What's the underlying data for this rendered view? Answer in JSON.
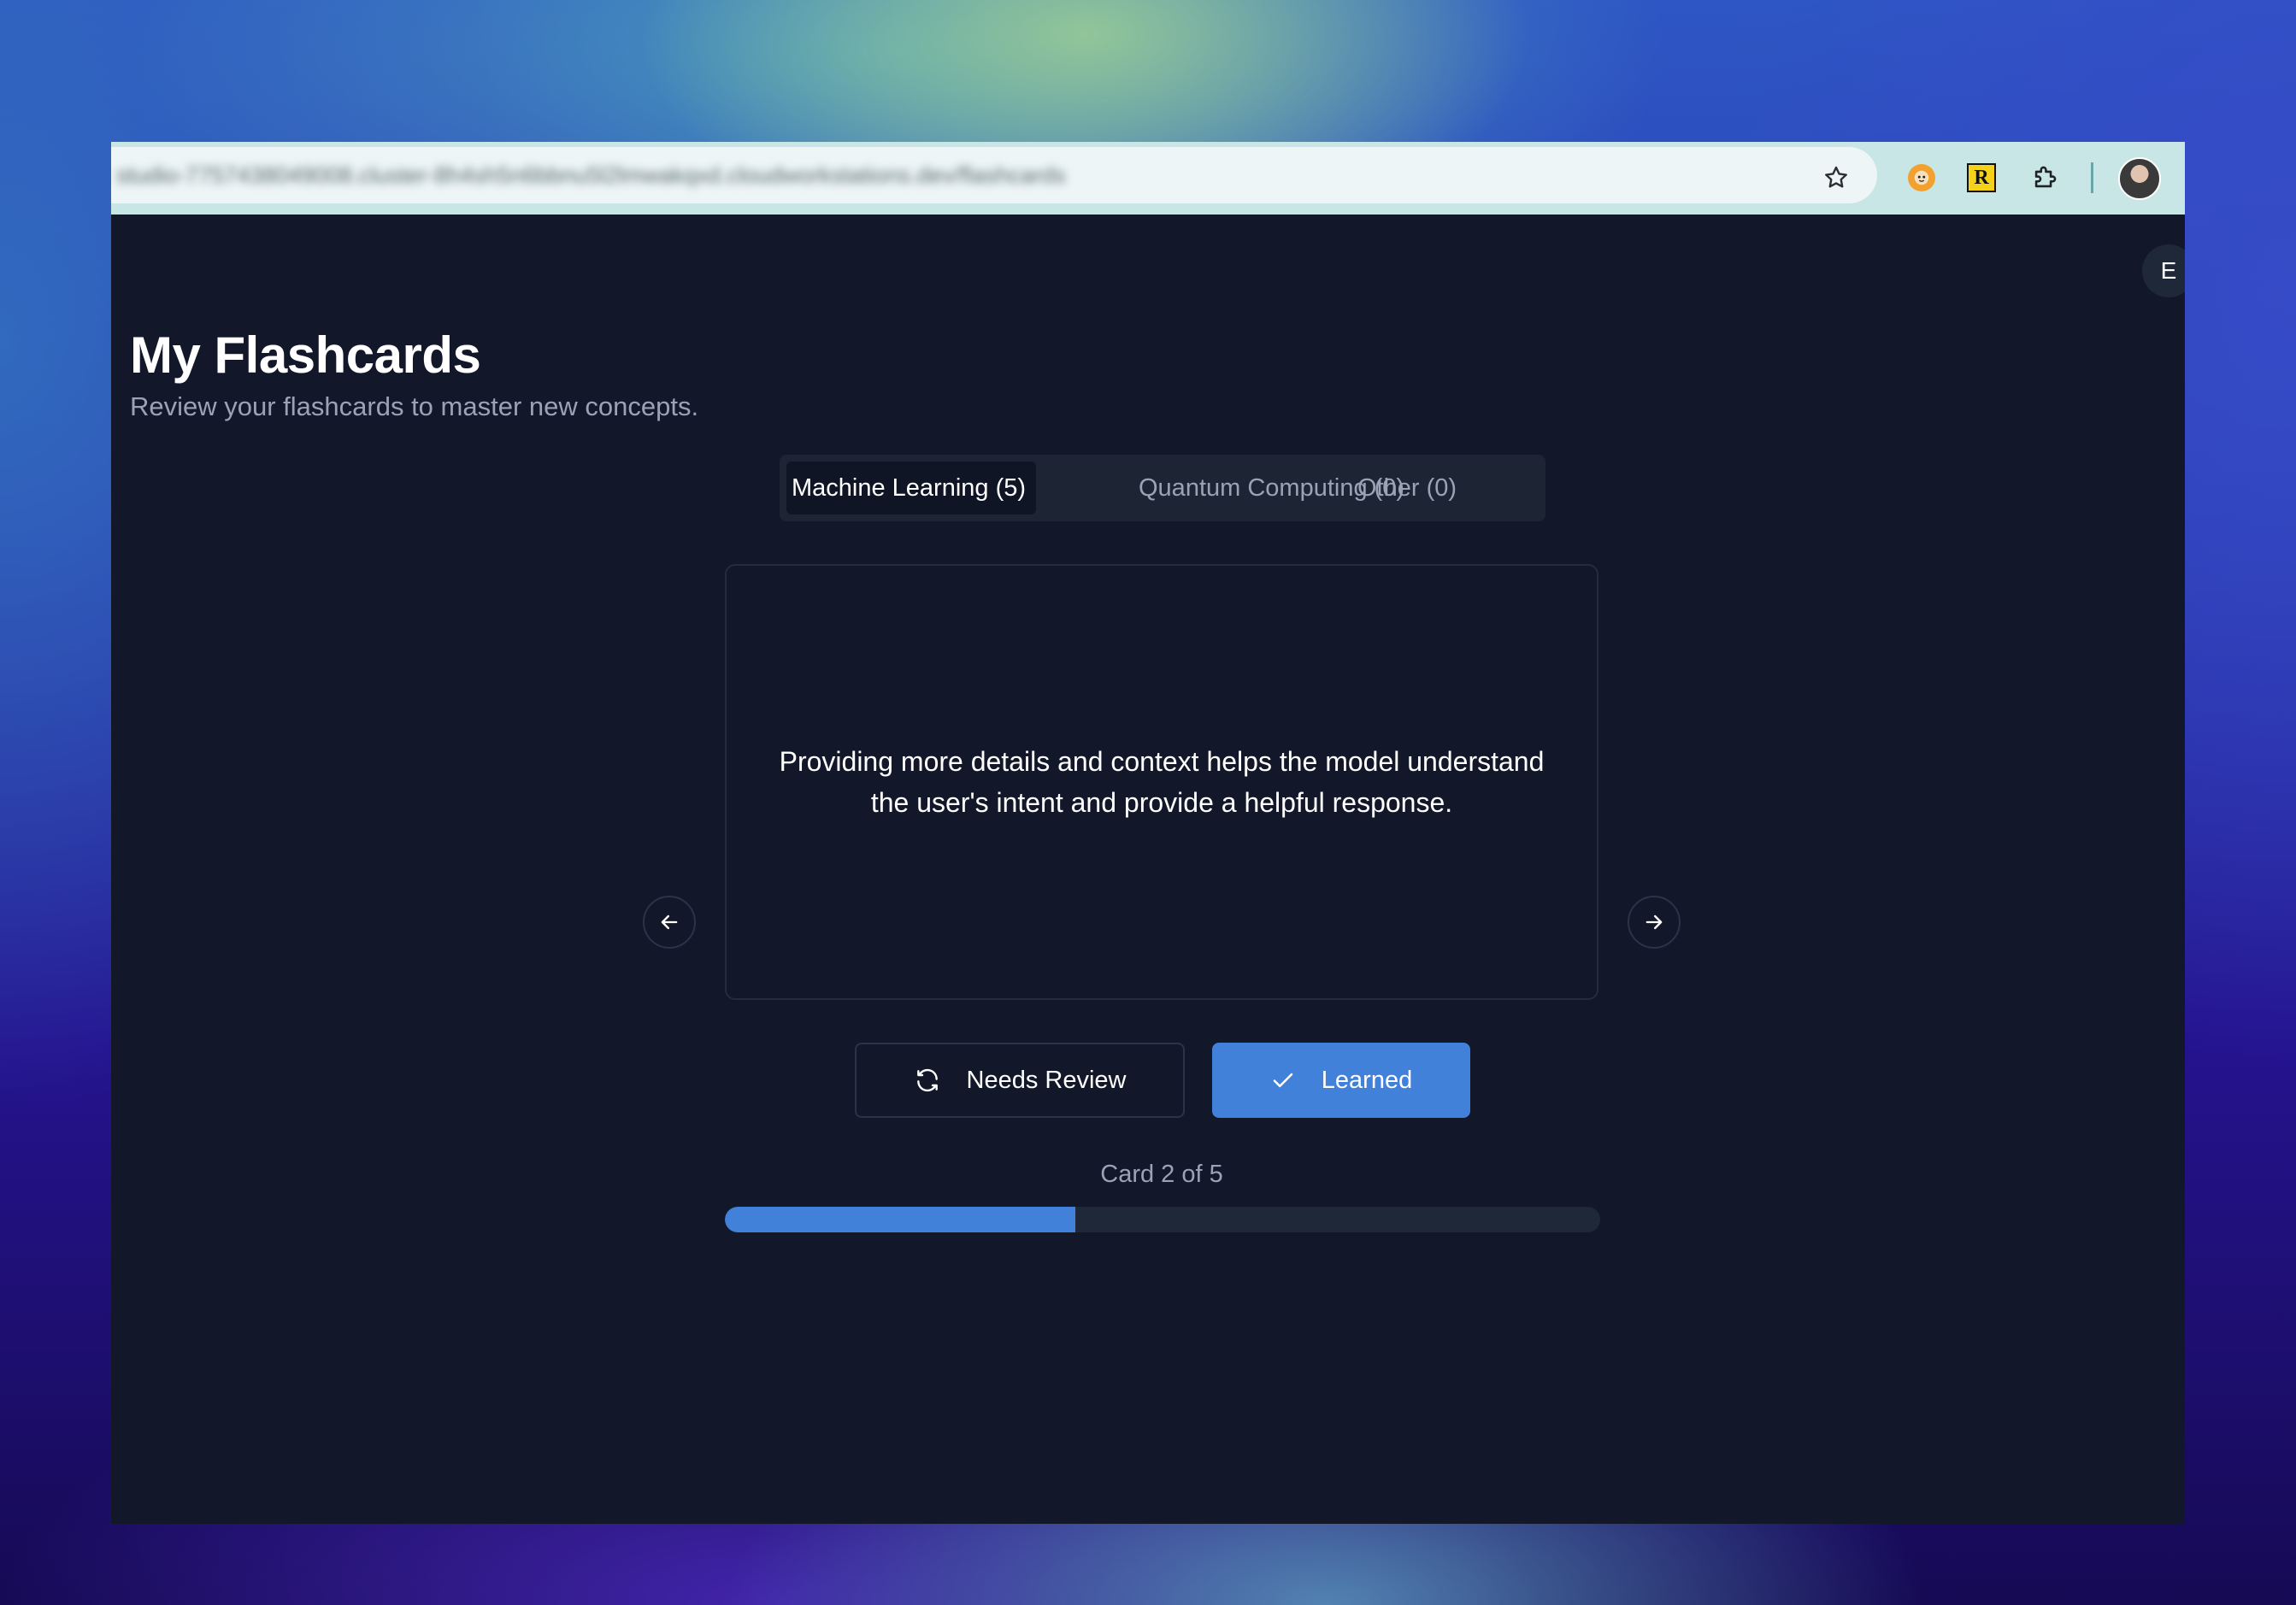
{
  "browser": {
    "url": "studio-7757438049008.cluster-8h4sh5n6bbnu5l2lmwakqxd.cloudworkstations.dev/flashcards"
  },
  "user": {
    "avatar_initial": "E"
  },
  "page": {
    "title": "My Flashcards",
    "subtitle": "Review your flashcards to master new concepts."
  },
  "tabs": [
    {
      "label": "Machine Learning (5)",
      "active": true
    },
    {
      "label": "Quantum Computing (0)",
      "active": false
    },
    {
      "label": "Other (0)",
      "active": false
    }
  ],
  "card": {
    "text": "Providing more details and context helps the model understand the user's intent and provide a helpful response."
  },
  "actions": {
    "needs_review_label": "Needs Review",
    "learned_label": "Learned"
  },
  "progress": {
    "counter_text": "Card 2 of 5",
    "current": 2,
    "total": 5,
    "fraction": 0.4
  },
  "icons": {
    "bookmark": "star-icon",
    "extension_1": "monkey-face-icon",
    "extension_2": "r-badge-icon",
    "extension_3": "puzzle-icon",
    "profile": "avatar",
    "prev": "arrow-left-icon",
    "next": "arrow-right-icon",
    "review": "refresh-icon",
    "learned": "check-icon"
  },
  "colors": {
    "background": "#121829",
    "accent": "#4281d9",
    "muted_text": "#9aa3b5",
    "surface": "#1d2535"
  }
}
